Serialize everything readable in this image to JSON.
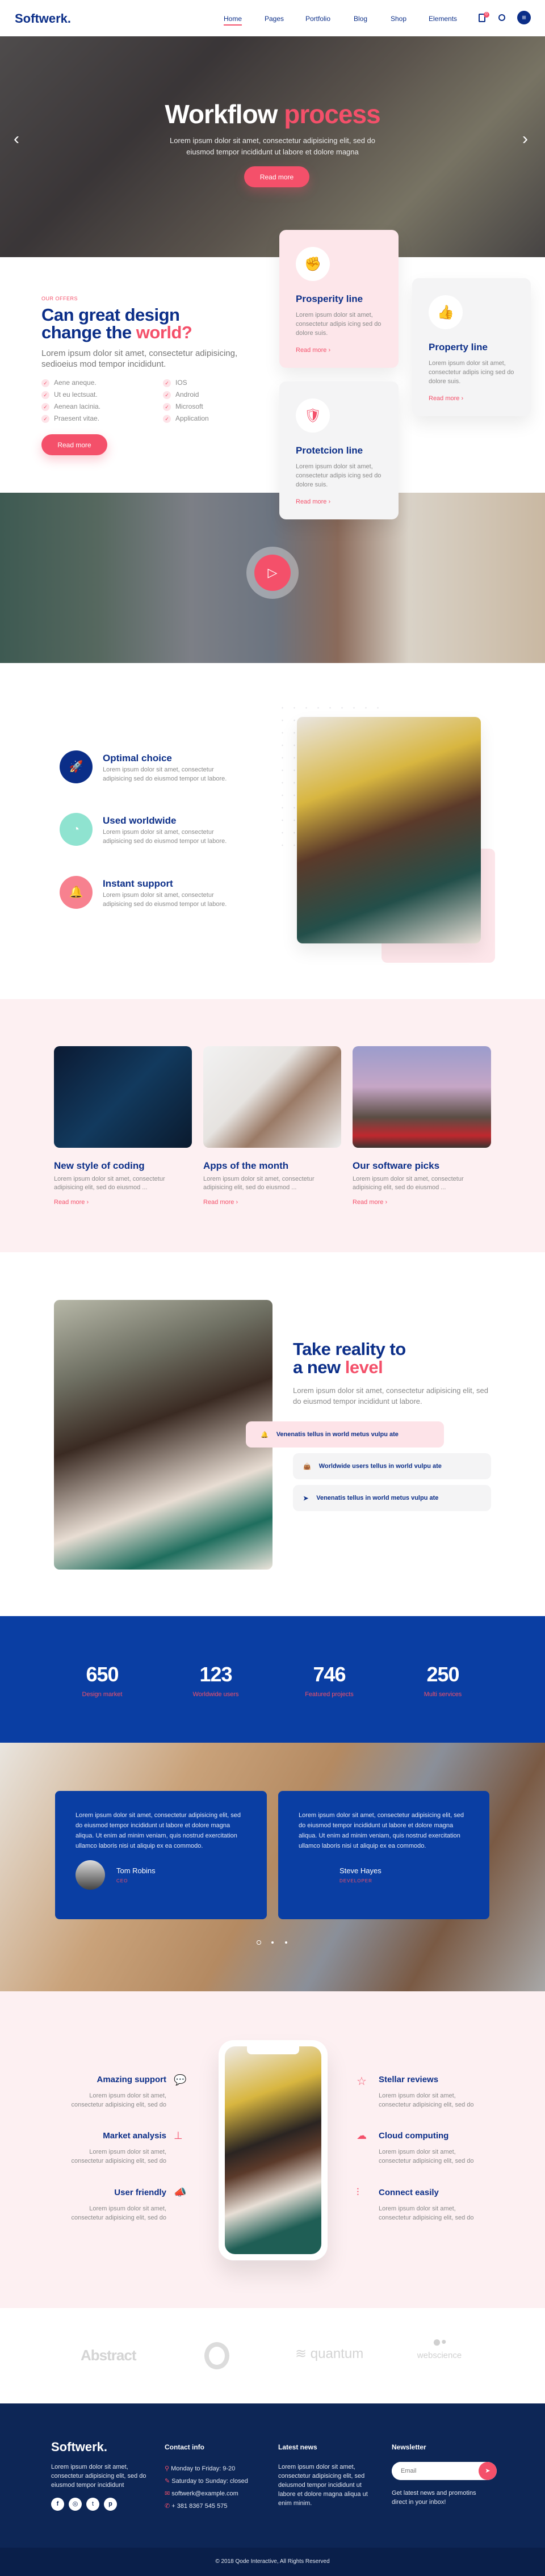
{
  "nav": {
    "logo": "Softwerk.",
    "items": [
      "Home",
      "Pages",
      "Portfolio",
      "Blog",
      "Shop",
      "Elements"
    ],
    "cart_count": "0"
  },
  "hero": {
    "title_a": "Workflow",
    "title_b": "process",
    "text_1": "Lorem ipsum dolor sit amet, consectetur adipisicing elit, sed do",
    "text_2": "eiusmod tempor incididunt ut labore et dolore magna",
    "button": "Read more"
  },
  "offers": {
    "eyebrow": "OUR OFFERS",
    "heading_a": "Can great design",
    "heading_b": "change the ",
    "heading_accent": "world?",
    "text": "Lorem ipsum dolor sit amet, consectetur adipisicing, sedioeius mod tempor incididunt.",
    "list_left": [
      "Aene aneque.",
      "Ut eu lectsuat.",
      "Aenean lacinia.",
      "Praesent vitae."
    ],
    "list_right": [
      "IOS",
      "Android",
      "Microsoft",
      "Application"
    ],
    "button": "Read more",
    "cards": [
      {
        "title": "Prosperity line",
        "text": "Lorem ipsum dolor sit amet, consectetur adipis icing sed do dolore suis.",
        "link": "Read more"
      },
      {
        "title": "Property line",
        "text": "Lorem ipsum dolor sit amet, consectetur adipis icing sed do dolore suis.",
        "link": "Read more"
      },
      {
        "title": "Protetcion line",
        "text": "Lorem ipsum dolor sit amet, consectetur adipis icing sed do dolore suis.",
        "link": "Read more"
      }
    ]
  },
  "features": {
    "items": [
      {
        "title": "Optimal choice",
        "text": "Lorem ipsum dolor sit amet, consectetur adipisicing sed do eiusmod tempor ut labore.",
        "color": "#0b2e88"
      },
      {
        "title": "Used worldwide",
        "text": "Lorem ipsum dolor sit amet, consectetur adipisicing sed do eiusmod tempor ut labore.",
        "color": "#8fe3d0"
      },
      {
        "title": "Instant support",
        "text": "Lorem ipsum dolor sit amet, consectetur adipisicing sed do eiusmod tempor ut labore.",
        "color": "#f7818f"
      }
    ]
  },
  "blog": {
    "posts": [
      {
        "title": "New style of coding",
        "text": "Lorem ipsum dolor sit amet, consectetur adipisicing elit, sed do eiusmod ...",
        "link": "Read more"
      },
      {
        "title": "Apps of the month",
        "text": "Lorem ipsum dolor sit amet, consectetur adipisicing elit, sed do eiusmod ...",
        "link": "Read more"
      },
      {
        "title": "Our software picks",
        "text": "Lorem ipsum dolor sit amet, consectetur adipisicing elit, sed do eiusmod ...",
        "link": "Read more"
      }
    ]
  },
  "reality": {
    "heading_a": "Take reality to",
    "heading_b": "a new ",
    "heading_accent": "level",
    "text": "Lorem ipsum dolor sit amet, consectetur adipisicing elit, sed do eiusmod tempor incididunt ut labore.",
    "pills": [
      "Venenatis tellus in world metus vulpu ate",
      "Worldwide users tellus in world vulpu ate",
      "Venenatis tellus in world metus vulpu ate"
    ]
  },
  "stats": {
    "items": [
      {
        "value": "650",
        "label": "Design market"
      },
      {
        "value": "123",
        "label": "Worldwide users"
      },
      {
        "value": "746",
        "label": "Featured projects"
      },
      {
        "value": "250",
        "label": "Multi services"
      }
    ]
  },
  "testimonials": [
    {
      "text": "Lorem ipsum dolor sit amet, consectetur adipisicing elit, sed do eiusmod tempor incididunt ut labore et dolore magna aliqua. Ut enim ad minim veniam, quis nostrud exercitation ullamco laboris nisi ut aliquip ex ea commodo.",
      "name": "Tom Robins",
      "role": "CEO"
    },
    {
      "text": "Lorem ipsum dolor sit amet, consectetur adipisicing elit, sed do eiusmod tempor incididunt ut labore et dolore magna aliqua. Ut enim ad minim veniam, quis nostrud exercitation ullamco laboris nisi ut aliquip ex ea commodo.",
      "name": "Steve Hayes",
      "role": "DEVELOPER"
    }
  ],
  "apps": {
    "left": [
      {
        "title": "Amazing support",
        "text": "Lorem ipsum dolor sit amet, consectetur adipisicing elit, sed do"
      },
      {
        "title": "Market analysis",
        "text": "Lorem ipsum dolor sit amet, consectetur adipisicing elit, sed do"
      },
      {
        "title": "User friendly",
        "text": "Lorem ipsum dolor sit amet, consectetur adipisicing elit, sed do"
      }
    ],
    "right": [
      {
        "title": "Stellar reviews",
        "text": "Lorem ipsum dolor sit amet, consectetur adipisicing elit, sed do"
      },
      {
        "title": "Cloud computing",
        "text": "Lorem ipsum dolor sit amet, consectetur adipisicing elit, sed do"
      },
      {
        "title": "Connect easily",
        "text": "Lorem ipsum dolor sit amet, consectetur adipisicing elit, sed do"
      }
    ]
  },
  "logos": [
    "Abstract",
    "quantum",
    "webscience"
  ],
  "footer": {
    "logo": "Softwerk.",
    "text": "Lorem ipsum dolor sit amet, consectetur adipisicing elit, sed do eiusmod tempor incididunt",
    "contact_title": "Contact info",
    "contact": [
      "Monday to Friday: 9-20",
      "Saturday to Sunday: closed",
      "softwerk@example.com",
      "+ 381 8367 545 575"
    ],
    "news_title": "Latest news",
    "news_text": "Lorem ipsum dolor sit amet, consectetur adipisicing elit, sed deiusmod tempor incididunt ut labore et dolore magna aliqua ut enim minim.",
    "newsletter_title": "Newsletter",
    "email_placeholder": "Email",
    "newsletter_text": "Get latest news and promotins direct in your inbox!",
    "copyright": "© 2018 Qode Interactive, All Rights Reserved"
  },
  "colors": {
    "navy": "#0b2e88",
    "accent": "#f4506a",
    "stats_bg": "#0a3ea3",
    "footer_bg": "#0d2656",
    "soft_pink": "#fdf0f2"
  }
}
